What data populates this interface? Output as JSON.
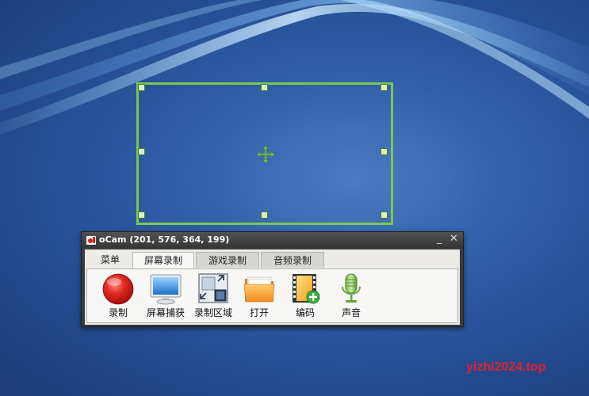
{
  "window": {
    "title": "oCam (201, 576, 364, 199)",
    "minimize_glyph": "_",
    "close_glyph": "✕"
  },
  "tabs": [
    {
      "label": "菜单"
    },
    {
      "label": "屏幕录制"
    },
    {
      "label": "游戏录制"
    },
    {
      "label": "音频录制"
    }
  ],
  "active_tab": "屏幕录制",
  "toolbar": [
    {
      "label": "录制",
      "icon": "record-icon"
    },
    {
      "label": "屏幕捕获",
      "icon": "monitor-icon"
    },
    {
      "label": "录制区域",
      "icon": "resize-area-icon"
    },
    {
      "label": "打开",
      "icon": "folder-icon"
    },
    {
      "label": "编码",
      "icon": "film-add-icon"
    },
    {
      "label": "声音",
      "icon": "microphone-icon"
    }
  ],
  "watermark": "yizhi2024.top",
  "colors": {
    "frame_border": "#7cc750",
    "record_red": "#d8261f",
    "desktop_blue": "#2f5aa0",
    "watermark_red": "#e0232b"
  }
}
